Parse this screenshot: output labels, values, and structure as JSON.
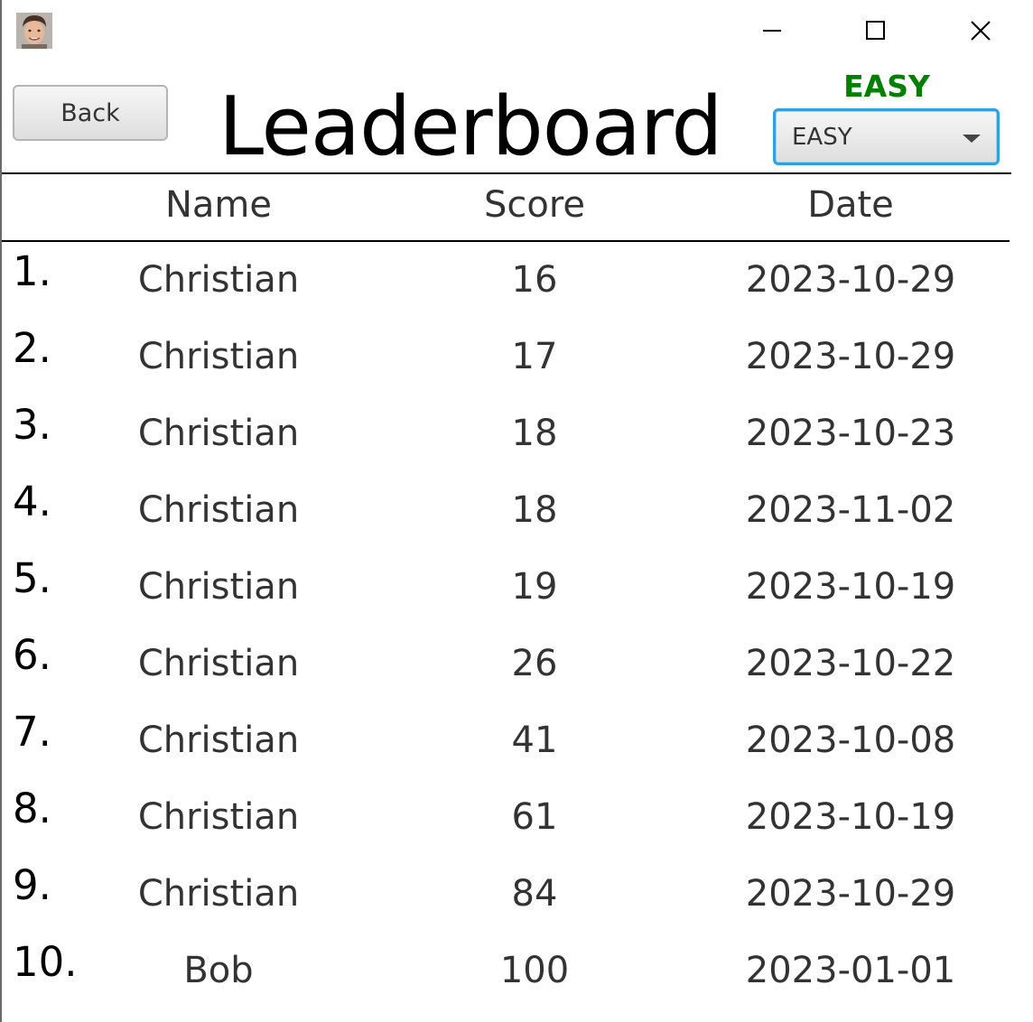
{
  "window": {
    "controls": {
      "minimize": "minimize-icon",
      "maximize": "maximize-icon",
      "close": "close-icon"
    }
  },
  "header": {
    "back_label": "Back",
    "title": "Leaderboard",
    "difficulty_label": "EASY",
    "difficulty_selected": "EASY"
  },
  "table": {
    "columns": [
      "Name",
      "Score",
      "Date"
    ],
    "rows": [
      {
        "rank": "1.",
        "name": "Christian",
        "score": "16",
        "date": "2023-10-29"
      },
      {
        "rank": "2.",
        "name": "Christian",
        "score": "17",
        "date": "2023-10-29"
      },
      {
        "rank": "3.",
        "name": "Christian",
        "score": "18",
        "date": "2023-10-23"
      },
      {
        "rank": "4.",
        "name": "Christian",
        "score": "18",
        "date": "2023-11-02"
      },
      {
        "rank": "5.",
        "name": "Christian",
        "score": "19",
        "date": "2023-10-19"
      },
      {
        "rank": "6.",
        "name": "Christian",
        "score": "26",
        "date": "2023-10-22"
      },
      {
        "rank": "7.",
        "name": "Christian",
        "score": "41",
        "date": "2023-10-08"
      },
      {
        "rank": "8.",
        "name": "Christian",
        "score": "61",
        "date": "2023-10-19"
      },
      {
        "rank": "9.",
        "name": "Christian",
        "score": "84",
        "date": "2023-10-29"
      },
      {
        "rank": "10.",
        "name": "Bob",
        "score": "100",
        "date": "2023-01-01"
      }
    ]
  },
  "colors": {
    "difficulty_label": "#008000",
    "select_focus": "#2aa3e0"
  }
}
